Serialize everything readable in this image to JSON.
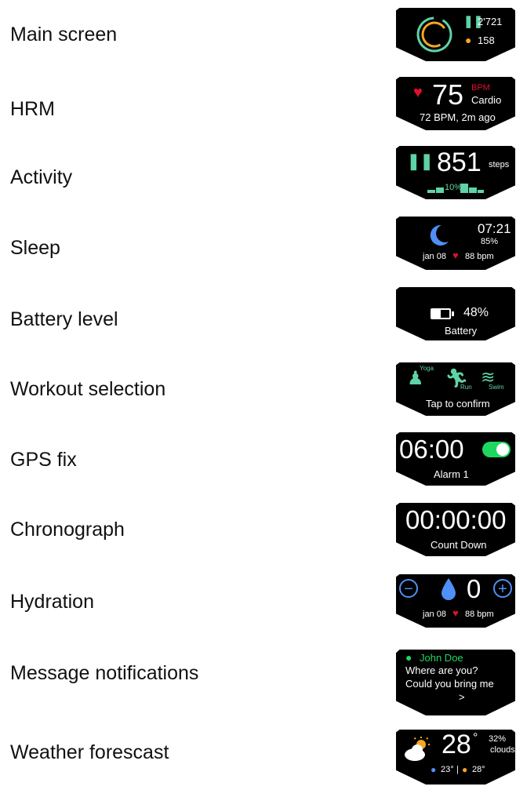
{
  "rows": [
    {
      "label": "Main screen"
    },
    {
      "label": "HRM"
    },
    {
      "label": "Activity"
    },
    {
      "label": "Sleep"
    },
    {
      "label": "Battery level"
    },
    {
      "label": "Workout selection"
    },
    {
      "label": "GPS fix"
    },
    {
      "label": "Chronograph"
    },
    {
      "label": "Hydration"
    },
    {
      "label": "Message notifications"
    },
    {
      "label": "Weather forescast"
    }
  ],
  "main": {
    "steps": "2'721",
    "calories": "158",
    "colors": {
      "ring_outer": "#5fd3a6",
      "ring_inner": "#f5a623"
    }
  },
  "hrm": {
    "bpm": "75",
    "unit": "BPM",
    "zone": "Cardio",
    "last": "72 BPM, 2m ago",
    "colors": {
      "heart": "#e0102a",
      "unit": "#e0102a"
    }
  },
  "activity": {
    "steps": "851",
    "unit": "steps",
    "progress_label": "10%"
  },
  "sleep": {
    "time": "07:21",
    "quality": "85%",
    "date": "jan 08",
    "bpm": "88 bpm",
    "colors": {
      "moon": "#4f8ff7"
    }
  },
  "battery": {
    "level": "48%",
    "label": "Battery",
    "fill": 0.48
  },
  "workout": {
    "options": [
      "Yoga",
      "Run",
      "Swim"
    ],
    "hint": "Tap to confirm"
  },
  "gps": {
    "time": "06:00",
    "label": "Alarm 1",
    "toggle_on": true,
    "colors": {
      "toggle": "#1ed760"
    }
  },
  "chrono": {
    "time": "00:00:00",
    "label": "Count Down"
  },
  "hydration": {
    "count": "0",
    "date": "jan 08",
    "bpm": "88 bpm",
    "colors": {
      "accent": "#4f8ff7"
    }
  },
  "message": {
    "sender": "John Doe",
    "line1": "Where are you?",
    "line2": "Could you bring me",
    "more": ">",
    "colors": {
      "sender": "#1ed760"
    }
  },
  "weather": {
    "temp": "28",
    "degree": "°",
    "humidity": "32%",
    "condition": "clouds",
    "low": "23°",
    "sep": "|",
    "high": "28°",
    "colors": {
      "low": "#4f8ff7",
      "high": "#f5a623"
    }
  }
}
